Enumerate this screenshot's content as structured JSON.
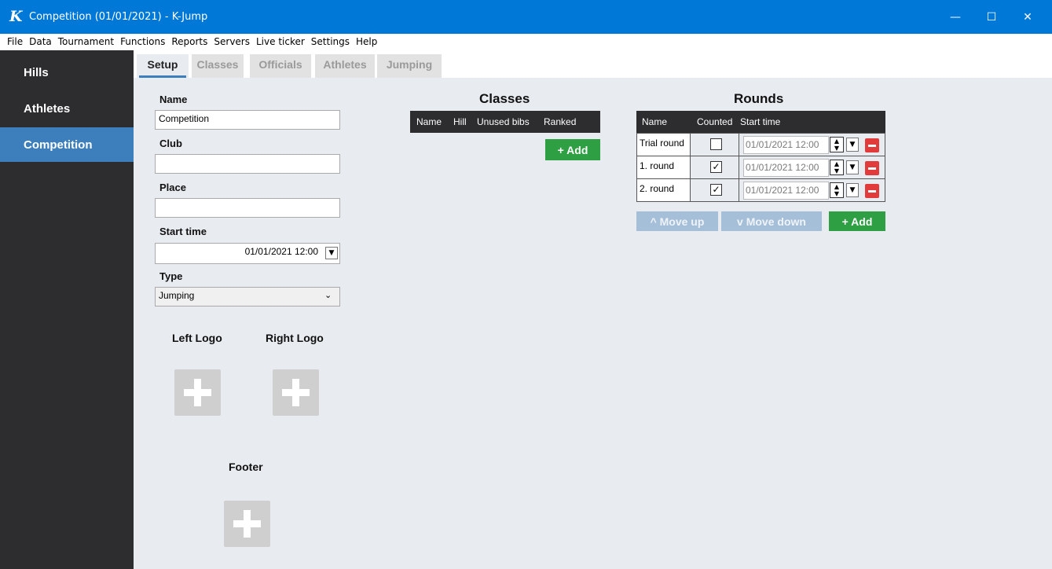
{
  "window": {
    "app_icon": "K",
    "title": "Competition (01/01/2021) - K-Jump",
    "min_icon": "minimize-icon",
    "max_icon": "maximize-icon",
    "close_icon": "close-icon"
  },
  "menu": [
    "File",
    "Data",
    "Tournament",
    "Functions",
    "Reports",
    "Servers",
    "Live ticker",
    "Settings",
    "Help"
  ],
  "sidebar": {
    "items": [
      {
        "label": "Hills"
      },
      {
        "label": "Athletes"
      },
      {
        "label": "Competition",
        "active": true
      }
    ]
  },
  "tabs": [
    "Setup",
    "Classes",
    "Officials",
    "Athletes",
    "Jumping"
  ],
  "form": {
    "name_label": "Name",
    "name_value": "Competition",
    "club_label": "Club",
    "club_value": "",
    "place_label": "Place",
    "place_value": "",
    "start_label": "Start time",
    "start_value": "01/01/2021 12:00",
    "type_label": "Type",
    "type_value": "Jumping"
  },
  "logos": {
    "left": "Left Logo",
    "right": "Right Logo",
    "footer": "Footer"
  },
  "classes": {
    "title": "Classes",
    "columns": [
      "Name",
      "Hill",
      "Unused bibs",
      "Ranked"
    ],
    "add_label": "+ Add"
  },
  "rounds": {
    "title": "Rounds",
    "columns": [
      "Name",
      "Counted",
      "Start time"
    ],
    "rows": [
      {
        "name": "Trial round",
        "counted": false,
        "time": "01/01/2021 12:00"
      },
      {
        "name": "1. round",
        "counted": true,
        "time": "01/01/2021 12:00"
      },
      {
        "name": "2. round",
        "counted": true,
        "time": "01/01/2021 12:00"
      }
    ],
    "move_up": "^ Move up",
    "move_down": "v Move down",
    "add_label": "+ Add"
  },
  "colors": {
    "titlebar": "#0078d7",
    "sidebar": "#2d2d30",
    "sidebar_active": "#3d7fbd",
    "content_bg": "#e8ebf0",
    "add_green": "#2ea043",
    "remove_red": "#e23b3b"
  }
}
